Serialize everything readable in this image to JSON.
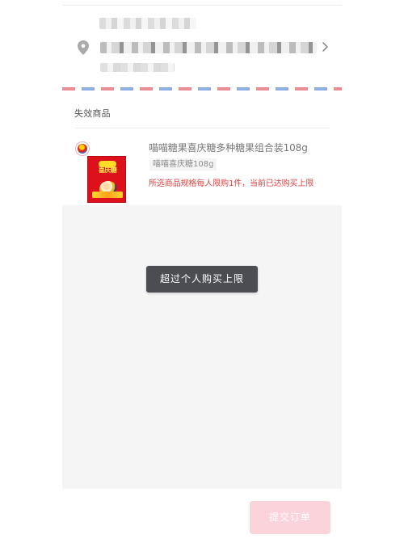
{
  "invalid_goods": {
    "title": "失效商品",
    "product": {
      "name": "喵喵糖果喜庆糖多种糖果组合装108g",
      "spec": "喵喵喜庆糖108g",
      "limit_message": "所选商品规格每人限购1件，当前已达购买上限",
      "image": {
        "brand_text": "喜庆糖"
      }
    }
  },
  "toast": {
    "message": "超过个人购买上限"
  },
  "footer": {
    "submit_label": "提交订单"
  },
  "colors": {
    "panel_background": "#f5f5f6",
    "airmail_red": "#eb8c95",
    "airmail_blue": "#8eaee3",
    "error_text": "#df4343",
    "disabled_submit": "#fbd3db",
    "toast_background": "#4b4d52"
  },
  "icons": {
    "location": "location-pin-icon",
    "forward": "chevron-right-icon"
  }
}
